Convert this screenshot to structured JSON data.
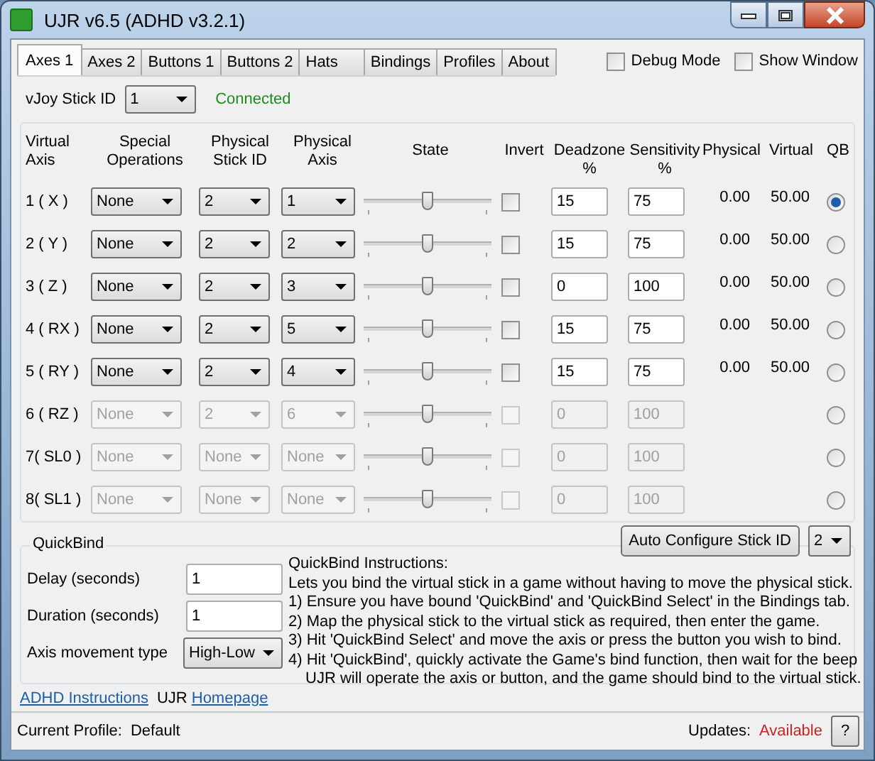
{
  "window": {
    "title": "UJR v6.5 (ADHD v3.2.1)"
  },
  "tabs": [
    {
      "label": "Axes 1",
      "selected": true
    },
    {
      "label": "Axes 2",
      "selected": false
    },
    {
      "label": "Buttons 1",
      "selected": false
    },
    {
      "label": "Buttons 2",
      "selected": false
    },
    {
      "label": "Hats",
      "selected": false
    },
    {
      "label": "Bindings",
      "selected": false
    },
    {
      "label": "Profiles",
      "selected": false
    },
    {
      "label": "About",
      "selected": false
    }
  ],
  "options": [
    {
      "label": "Debug Mode",
      "checked": false
    },
    {
      "label": "Show Window",
      "checked": false
    }
  ],
  "vjoy": {
    "label": "vJoy Stick ID",
    "value": "1",
    "status": "Connected"
  },
  "columns": [
    "Virtual\nAxis",
    "Special\nOperations",
    "Physical\nStick ID",
    "Physical\nAxis",
    "State",
    "Invert",
    "Deadzone\n%",
    "Sensitivity\n%",
    "Physical",
    "Virtual",
    "QB"
  ],
  "axes": [
    {
      "axis": "1  ( X )",
      "special": "None",
      "stick": "2",
      "physical_axis": "1",
      "level": 0.5,
      "invert": false,
      "deadzone": "15",
      "sensitivity": "75",
      "physical": "0.00",
      "virtual": "50.00",
      "selected": true,
      "disabled": false
    },
    {
      "axis": "2  ( Y )",
      "special": "None",
      "stick": "2",
      "physical_axis": "2",
      "level": 0.5,
      "invert": false,
      "deadzone": "15",
      "sensitivity": "75",
      "physical": "0.00",
      "virtual": "50.00",
      "selected": false,
      "disabled": false
    },
    {
      "axis": "3  ( Z )",
      "special": "None",
      "stick": "2",
      "physical_axis": "3",
      "level": 0.5,
      "invert": false,
      "deadzone": "0",
      "sensitivity": "100",
      "physical": "0.00",
      "virtual": "50.00",
      "selected": false,
      "disabled": false
    },
    {
      "axis": "4 ( RX )",
      "special": "None",
      "stick": "2",
      "physical_axis": "5",
      "level": 0.5,
      "invert": false,
      "deadzone": "15",
      "sensitivity": "75",
      "physical": "0.00",
      "virtual": "50.00",
      "selected": false,
      "disabled": false
    },
    {
      "axis": "5 ( RY )",
      "special": "None",
      "stick": "2",
      "physical_axis": "4",
      "level": 0.5,
      "invert": false,
      "deadzone": "15",
      "sensitivity": "75",
      "physical": "0.00",
      "virtual": "50.00",
      "selected": false,
      "disabled": false
    },
    {
      "axis": "6 ( RZ )",
      "special": "None",
      "stick": "2",
      "physical_axis": "6",
      "level": 0.5,
      "invert": false,
      "deadzone": "0",
      "sensitivity": "100",
      "selected": false,
      "disabled": true
    },
    {
      "axis": "7( SL0 )",
      "special": "None",
      "stick": "None",
      "physical_axis": "None",
      "level": 0.5,
      "invert": false,
      "deadzone": "0",
      "sensitivity": "100",
      "selected": false,
      "disabled": true
    },
    {
      "axis": "8( SL1 )",
      "special": "None",
      "stick": "None",
      "physical_axis": "None",
      "level": 0.5,
      "invert": false,
      "deadzone": "0",
      "sensitivity": "100",
      "selected": false,
      "disabled": true
    }
  ],
  "auto_configure": {
    "button": "Auto Configure Stick ID",
    "value": "2"
  },
  "quickbind": {
    "title": "QuickBind",
    "fields": [
      {
        "label": "Delay (seconds)",
        "value": "1",
        "kind": "text"
      },
      {
        "label": "Duration (seconds)",
        "value": "1",
        "kind": "text"
      },
      {
        "label": "Axis movement type",
        "value": "High-Low",
        "kind": "dropdown"
      }
    ],
    "instructions_title": "QuickBind Instructions:",
    "instructions": [
      {
        "text": "Lets you bind the virtual stick in a game without having to move the physical stick.",
        "kind": "line"
      },
      {
        "text": "1) Ensure you have bound 'QuickBind' and 'QuickBind Select' in the Bindings tab.",
        "kind": "line"
      },
      {
        "text": "2) Map the physical stick to the virtual stick as required, then enter the game.",
        "kind": "line"
      },
      {
        "text": "3) Hit 'QuickBind Select' and move the axis or press the button you wish to bind.",
        "kind": "line"
      },
      {
        "text": "4) Hit 'QuickBind', quickly activate the Game's bind function, then wait for the beep",
        "kind": "line"
      },
      {
        "text": "UJR will operate the axis or button, and the game should bind to the virtual stick.",
        "kind": "continuation"
      }
    ]
  },
  "links": [
    {
      "text": "ADHD Instructions",
      "kind": "link"
    },
    {
      "text": "UJR",
      "kind": "text"
    },
    {
      "text": "Homepage",
      "kind": "link"
    }
  ],
  "status_bar": {
    "profile_label": "Current Profile:",
    "profile": "Default",
    "updates_label": "Updates:",
    "updates": "Available",
    "help": "?"
  }
}
